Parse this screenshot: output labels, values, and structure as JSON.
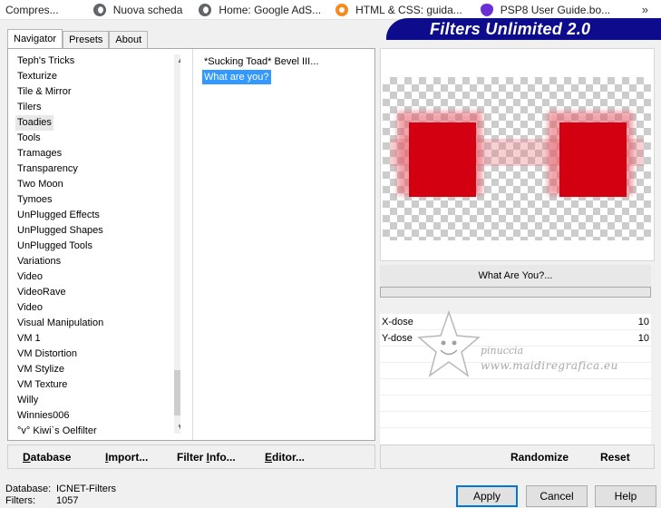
{
  "bookmarks": [
    {
      "label": "Compres...",
      "icon": "none"
    },
    {
      "label": "Nuova scheda",
      "icon": "globe-icon"
    },
    {
      "label": "Home: Google AdS...",
      "icon": "globe-icon"
    },
    {
      "label": "HTML & CSS: guida...",
      "icon": "lifebuoy-icon"
    },
    {
      "label": "PSP8 User Guide.bo...",
      "icon": "pin-icon"
    }
  ],
  "bookmarks_more": "»",
  "tabs": [
    "Navigator",
    "Presets",
    "About"
  ],
  "brand": "Filters Unlimited 2.0",
  "categories": [
    "Teph's Tricks",
    "Texturize",
    "Tile & Mirror",
    "Tilers",
    "Toadies",
    "Tools",
    "Tramages",
    "Transparency",
    "Two Moon",
    "Tymoes",
    "UnPlugged Effects",
    "UnPlugged Shapes",
    "UnPlugged Tools",
    "Variations",
    "Video",
    "VideoRave",
    "Video",
    "Visual Manipulation",
    "VM 1",
    "VM Distortion",
    "VM Stylize",
    "VM Texture",
    "Willy",
    "Winnies006",
    "°v° Kiwi`s Oelfilter"
  ],
  "selected_category": "Toadies",
  "filters": [
    "*Sucking Toad*  Bevel III...",
    "What are you?"
  ],
  "selected_filter": "What are you?",
  "bottom_left_buttons": [
    {
      "key": "D",
      "rest": "atabase"
    },
    {
      "key": "I",
      "rest": "mport..."
    },
    {
      "pre": "Filter ",
      "key": "I",
      "rest": "nfo..."
    },
    {
      "key": "E",
      "rest": "ditor..."
    }
  ],
  "filter_title": "What Are You?...",
  "params": [
    {
      "label": "X-dose",
      "value": "10"
    },
    {
      "label": "Y-dose",
      "value": "10"
    }
  ],
  "watermark": {
    "name": "pinuccia",
    "site": "www.maidiregrafica.eu"
  },
  "bottom_right_buttons": [
    "Randomize",
    "Reset"
  ],
  "status": {
    "database_label": "Database:",
    "database_value": "ICNET-Filters",
    "filters_label": "Filters:",
    "filters_value": "1057"
  },
  "dialog_buttons": {
    "apply": "Apply",
    "cancel": "Cancel",
    "help": "Help"
  },
  "colors": {
    "brand_bg": "#0c0c8c",
    "preview_red": "#d20010",
    "selection_blue": "#3399ff"
  }
}
